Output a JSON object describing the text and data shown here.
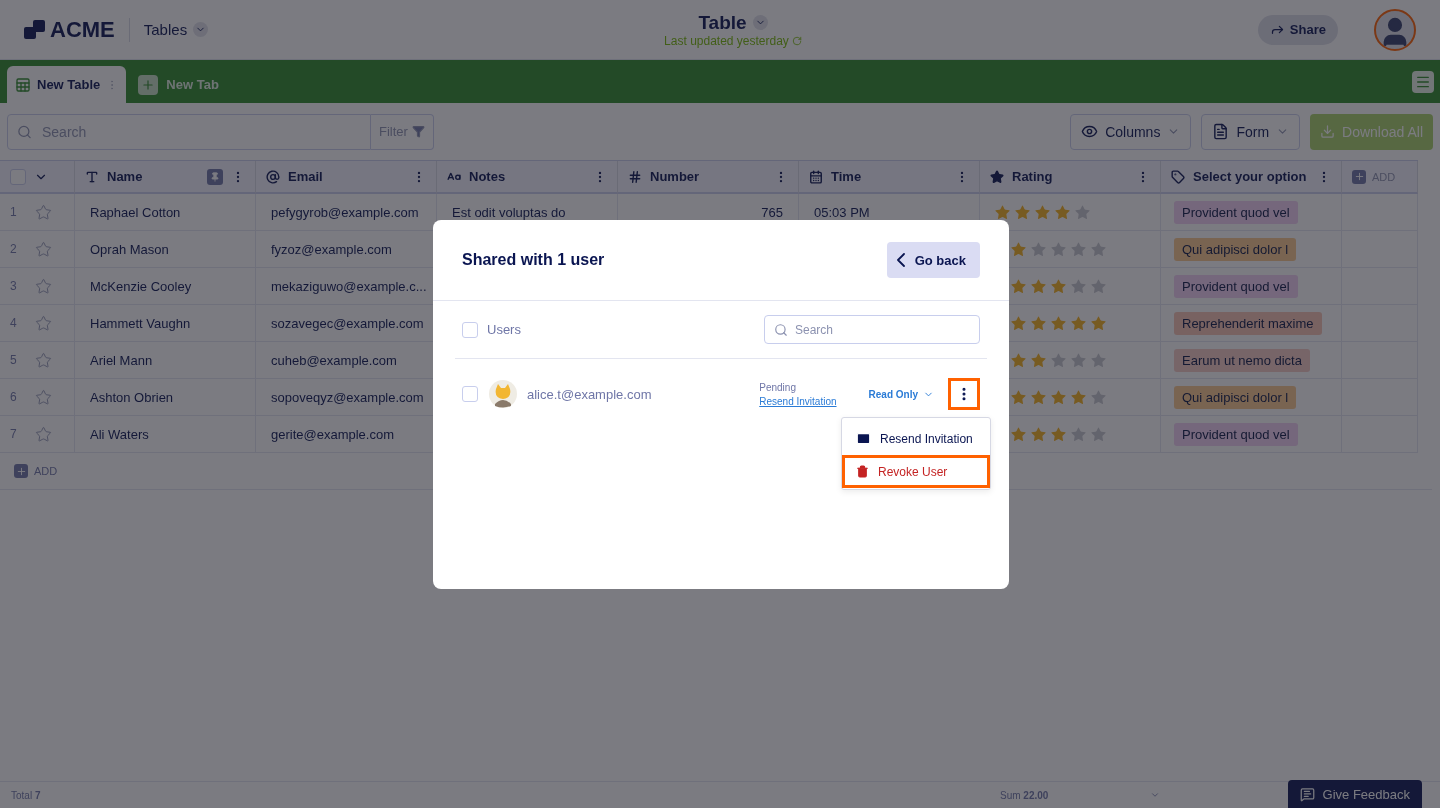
{
  "header": {
    "logo": "ACME",
    "section": "Tables",
    "title": "Table",
    "subtitle": "Last updated yesterday",
    "share_button": "Share"
  },
  "tabs": [
    {
      "label": "New Table",
      "selected": true
    }
  ],
  "new_tab": "New Tab",
  "toolbar": {
    "search": {
      "placeholder": "Search"
    },
    "filter": "Filter",
    "columns_button": "Columns",
    "form_button": "Form",
    "download_button": "Download All"
  },
  "table": {
    "select_all_checked": false,
    "columns": [
      {
        "label": "Name",
        "kind": "text",
        "pinned": true
      },
      {
        "label": "Email",
        "kind": "email",
        "pinned": false
      },
      {
        "label": "Notes",
        "kind": "textarea",
        "pinned": false
      },
      {
        "label": "Number",
        "kind": "number",
        "pinned": false
      },
      {
        "label": "Time",
        "kind": "time",
        "pinned": false
      },
      {
        "label": "Rating",
        "kind": "rating",
        "pinned": false
      },
      {
        "label": "Select your option",
        "kind": "select",
        "pinned": false
      }
    ],
    "add_column": "ADD",
    "rows": [
      {
        "index": "1",
        "favorite": false,
        "name": "Raphael Cotton",
        "email": "pefygyrob@example.com",
        "notes": "Est odit voluptas do",
        "number": "765",
        "time": "05:03 PM",
        "stars": 4,
        "option": {
          "label": "Provident quod vel",
          "color": "#75677c"
        }
      },
      {
        "index": "2",
        "favorite": false,
        "name": "Oprah Mason",
        "email": "fyzoz@example.com",
        "stars": 1,
        "option": {
          "label": "Qui adipisci dolor l",
          "color": "#796451"
        }
      },
      {
        "index": "3",
        "favorite": false,
        "name": "McKenzie Cooley",
        "email": "mekaziguwo@example.c...",
        "stars": 3,
        "option": {
          "label": "Provident quod vel",
          "color": "#75677c"
        }
      },
      {
        "index": "4",
        "favorite": false,
        "name": "Hammett Vaughn",
        "email": "sozavegec@example.com",
        "stars": 5,
        "option": {
          "label": "Reprehenderit maxime",
          "color": "#786261"
        }
      },
      {
        "index": "5",
        "favorite": false,
        "name": "Ariel Mann",
        "email": "cuheb@example.com",
        "stars": 2,
        "option": {
          "label": "Earum ut nemo dicta",
          "color": "#776568"
        }
      },
      {
        "index": "6",
        "favorite": false,
        "name": "Ashton Obrien",
        "email": "sopoveqyz@example.com",
        "stars": 4,
        "option": {
          "label": "Qui adipisci dolor l",
          "color": "#796451"
        }
      },
      {
        "index": "7",
        "favorite": false,
        "name": "Ali Waters",
        "email": "gerite@example.com",
        "stars": 3,
        "option": {
          "label": "Provident quod vel",
          "color": "#75677c"
        }
      }
    ],
    "add_row": "ADD"
  },
  "footer": {
    "total": "Total **7**",
    "sum": "Sum **22.00**",
    "feedback_button": "Give Feedback"
  },
  "modal": {
    "title": "Shared with 1 user",
    "back_button": "Go back",
    "select_all": {
      "label": "Users",
      "checked": false
    },
    "search": {
      "placeholder": "Search"
    },
    "users": [
      {
        "email": "alice.t@example.com",
        "checked": false,
        "status": "Pending",
        "resend_link": "Resend Invitation",
        "permission": "Read Only",
        "menu_highlighted": true
      }
    ],
    "menu": [
      {
        "kind": "mail",
        "label": "Resend Invitation",
        "highlighted": false
      },
      {
        "kind": "delete",
        "label": "Revoke User",
        "highlighted": true
      }
    ]
  }
}
